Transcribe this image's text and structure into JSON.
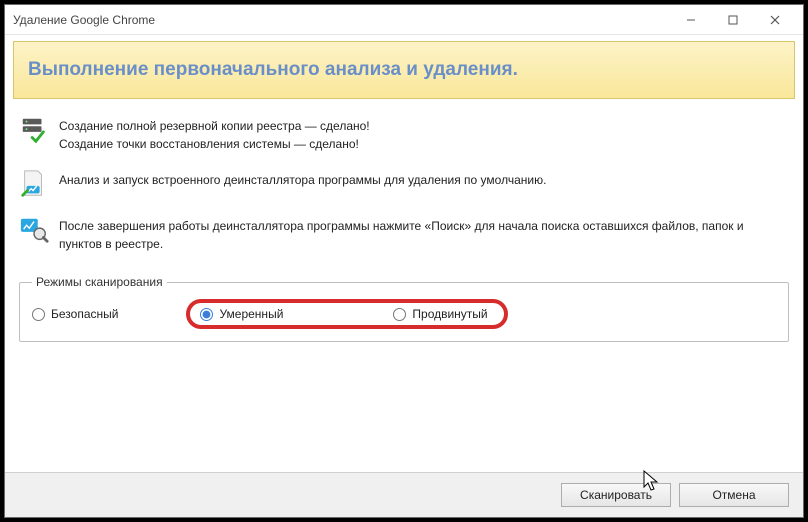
{
  "window": {
    "title": "Удаление Google Chrome"
  },
  "header": {
    "heading": "Выполнение первоначального анализа и удаления."
  },
  "steps": {
    "backup_line1": "Создание полной резервной копии реестра — сделано!",
    "backup_line2": "Создание точки восстановления системы — сделано!",
    "analysis": "Анализ и запуск встроенного деинсталлятора программы для удаления по умолчанию.",
    "post": "После завершения работы деинсталлятора программы нажмите «Поиск» для начала поиска оставшихся файлов, папок и пунктов в реестре."
  },
  "scan": {
    "legend": "Режимы сканирования",
    "safe": "Безопасный",
    "moderate": "Умеренный",
    "advanced": "Продвинутый",
    "selected": "moderate"
  },
  "footer": {
    "scan_btn": "Сканировать",
    "cancel_btn": "Отмена"
  }
}
